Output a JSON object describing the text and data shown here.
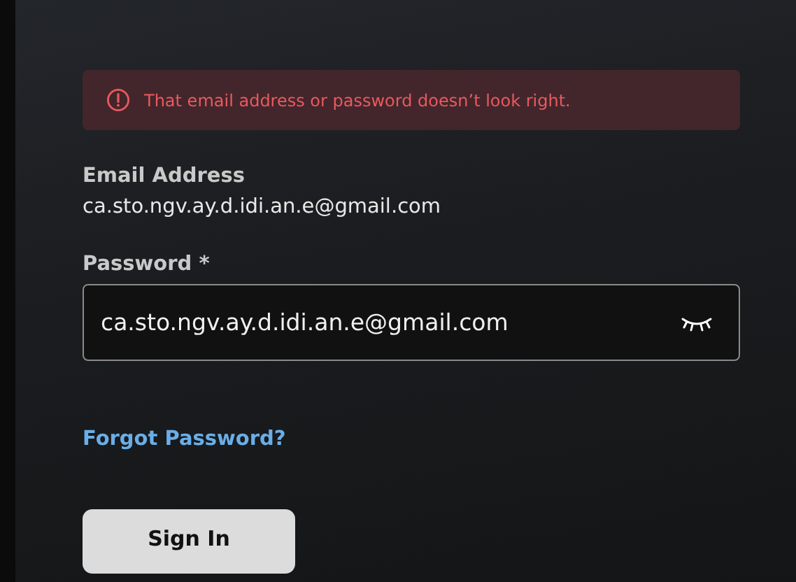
{
  "alert": {
    "message": "That email address or password doesn’t look right."
  },
  "email": {
    "label": "Email Address",
    "value": "ca.sto.ngv.ay.d.idi.an.e@gmail.com"
  },
  "password": {
    "label": "Password *",
    "value": "ca.sto.ngv.ay.d.idi.an.e@gmail.com"
  },
  "forgot_link": "Forgot Password?",
  "sign_in_button": "Sign In"
}
